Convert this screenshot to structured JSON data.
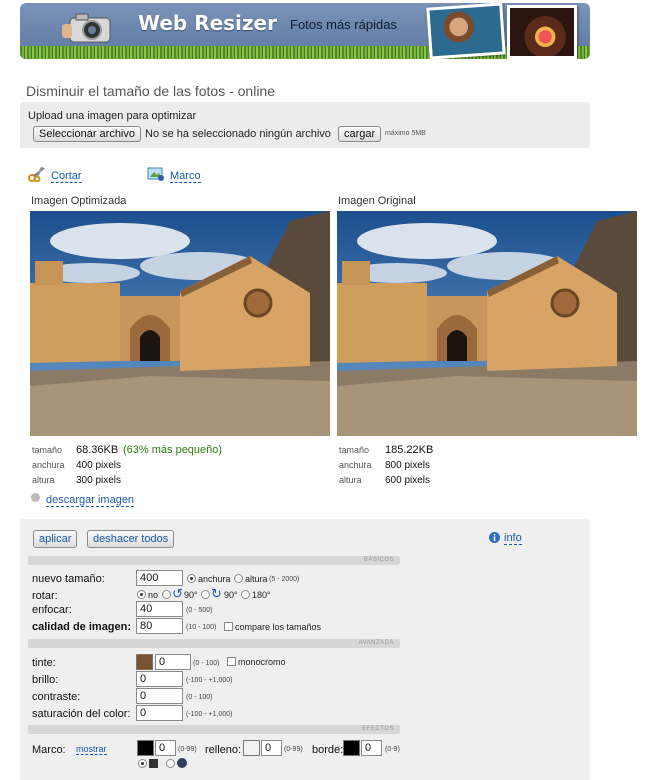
{
  "banner": {
    "title": "Web Resizer",
    "subtitle": "Fotos más rápidas"
  },
  "page": {
    "heading": "Disminuir el tamaño de las fotos - online"
  },
  "upload": {
    "label": "Upload una imagen para optimizar",
    "choose_button": "Seleccionar archivo",
    "no_file": "No se ha seleccionado ningún archivo",
    "upload_button": "cargar",
    "max_size": "máximo 5MB"
  },
  "tools": {
    "crop": "Cortar",
    "frame": "Marco"
  },
  "optimized": {
    "label": "Imagen Optimizada",
    "size_label": "tamaño",
    "size": "68.36KB",
    "saving": "(63% más pequeño)",
    "width_label": "anchura",
    "width": "400 pixels",
    "height_label": "altura",
    "height": "300 pixels",
    "download": "descargar imagen"
  },
  "original": {
    "label": "Imagen Original",
    "size_label": "tamaño",
    "size": "185.22KB",
    "width_label": "anchura",
    "width": "800 pixels",
    "height_label": "altura",
    "height": "600 pixels"
  },
  "actions": {
    "apply": "aplicar",
    "undo_all": "deshacer todos",
    "info": "info"
  },
  "sections": {
    "basic": "BÁSICOS",
    "advanced": "AVANZADA",
    "effects": "EFECTOS"
  },
  "basic": {
    "new_size_label": "nuevo tamaño:",
    "new_size_value": "400",
    "width_option": "anchura",
    "height_option": "altura",
    "height_range": "(5 - 2000)",
    "rotate_label": "rotar:",
    "rotate_no": "no",
    "rotate_left": "90°",
    "rotate_right": "90°",
    "rotate_180": "180°",
    "sharpen_label": "enfocar:",
    "sharpen_value": "40",
    "sharpen_range": "(0 - 500)",
    "quality_label": "calidad de imagen:",
    "quality_value": "80",
    "quality_range": "(10 - 100)",
    "compare_label": "compare los tamaños"
  },
  "advanced": {
    "tint_label": "tinte:",
    "tint_color": "#7a5230",
    "tint_value": "0",
    "tint_range": "(0 - 100)",
    "mono_label": "monocromo",
    "brightness_label": "brillo:",
    "brightness_value": "0",
    "brightness_range": "(-100 - +1,000)",
    "contrast_label": "contraste:",
    "contrast_value": "0",
    "contrast_range": "(0 - 100)",
    "saturation_label": "saturación del color:",
    "saturation_value": "0",
    "saturation_range": "(-100 - +1,000)"
  },
  "effects": {
    "frame_label": "Marco:",
    "show_link": "mostrar",
    "frame_color": "#000000",
    "frame_value": "0",
    "frame_range": "(0-99)",
    "fill_label": "relleno:",
    "fill_color": "#f2f2f2",
    "fill_value": "0",
    "fill_range": "(0-99)",
    "border_label": "borde:",
    "border_color": "#000000",
    "border_value": "0",
    "border_range": "(0-9)"
  }
}
